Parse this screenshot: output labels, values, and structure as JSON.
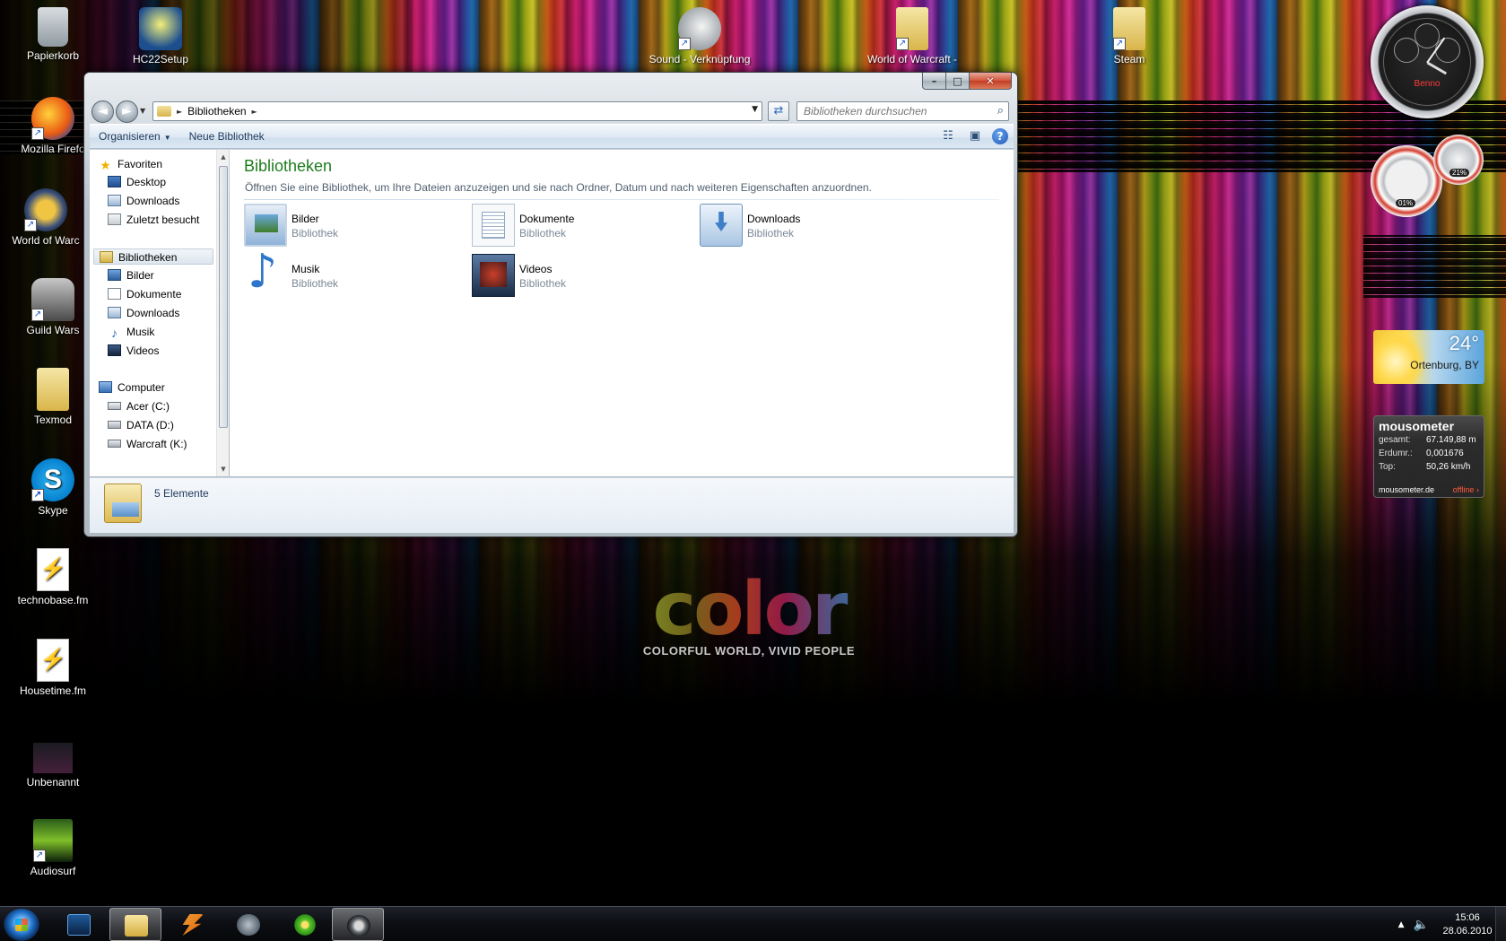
{
  "desktop": {
    "icons": [
      {
        "label": "Papierkorb",
        "icon": "recycle-bin-icon"
      },
      {
        "label": "HC22Setup",
        "icon": "setup-icon"
      },
      {
        "label": "Sound - Verknüpfung",
        "icon": "speaker-icon"
      },
      {
        "label": "World of Warcraft -",
        "icon": "folder-icon"
      },
      {
        "label": "Steam",
        "icon": "folder-icon"
      },
      {
        "label": "Mozilla Firefo",
        "icon": "firefox-icon"
      },
      {
        "label": "World of Warc",
        "icon": "wow-icon"
      },
      {
        "label": "Guild Wars",
        "icon": "guild-wars-icon"
      },
      {
        "label": "Texmod",
        "icon": "folder-icon"
      },
      {
        "label": "Skype",
        "icon": "skype-icon"
      },
      {
        "label": "technobase.fm",
        "icon": "playlist-icon"
      },
      {
        "label": "Housetime.fm",
        "icon": "playlist-icon"
      },
      {
        "label": "Unbenannt",
        "icon": "image-icon"
      },
      {
        "label": "Audiosurf",
        "icon": "audiosurf-icon"
      }
    ],
    "wallpaper": {
      "word": "color",
      "tagline": "COLORFUL WORLD, VIVID PEOPLE"
    }
  },
  "gadgets": {
    "clock": {
      "brand": "Benno"
    },
    "cpu": {
      "cpu_percent": "01%",
      "ram_percent": "21%"
    },
    "weather": {
      "temp": "24°",
      "location": "Ortenburg, BY"
    },
    "mousometer": {
      "title": "mousometer",
      "rows": [
        {
          "key": "gesamt:",
          "value": "67.149,88 m"
        },
        {
          "key": "Erdumr.:",
          "value": "0,001676"
        },
        {
          "key": "Top:",
          "value": "50,26 km/h"
        }
      ],
      "site": "mousometer.de",
      "status": "offline ›"
    }
  },
  "window": {
    "caption": {
      "minimize": "–",
      "maximize": "□",
      "close": "✕"
    },
    "address": {
      "crumb": "Bibliotheken"
    },
    "search": {
      "placeholder": "Bibliotheken durchsuchen"
    },
    "commands": {
      "organize": "Organisieren",
      "new_library": "Neue Bibliothek"
    },
    "nav": {
      "favorites": "Favoriten",
      "fav_items": [
        "Desktop",
        "Downloads",
        "Zuletzt besucht"
      ],
      "libraries": "Bibliotheken",
      "lib_items": [
        "Bilder",
        "Dokumente",
        "Downloads",
        "Musik",
        "Videos"
      ],
      "computer": "Computer",
      "drives": [
        "Acer (C:)",
        "DATA (D:)",
        "Warcraft (K:)"
      ]
    },
    "content": {
      "title": "Bibliotheken",
      "subtitle": "Öffnen Sie eine Bibliothek, um Ihre Dateien anzuzeigen und sie nach Ordner, Datum und nach weiteren Eigenschaften anzuordnen.",
      "libraries": [
        {
          "name": "Bilder",
          "kind": "Bibliothek"
        },
        {
          "name": "Dokumente",
          "kind": "Bibliothek"
        },
        {
          "name": "Downloads",
          "kind": "Bibliothek"
        },
        {
          "name": "Musik",
          "kind": "Bibliothek"
        },
        {
          "name": "Videos",
          "kind": "Bibliothek"
        }
      ]
    },
    "details": {
      "count": "5 Elemente"
    }
  },
  "taskbar": {
    "time": "15:06",
    "date": "28.06.2010"
  }
}
